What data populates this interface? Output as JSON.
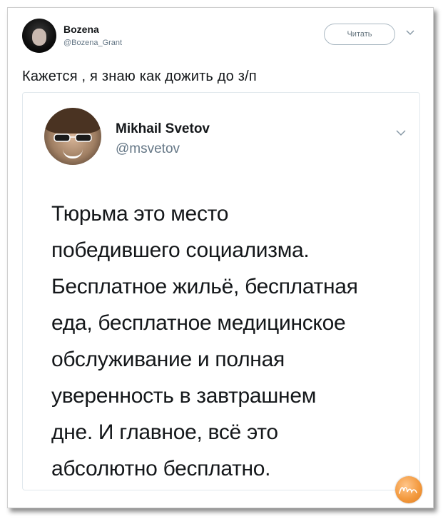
{
  "tweet": {
    "author_name": "Bozena",
    "author_handle": "@Bozena_Grant",
    "follow_label": "Читать",
    "text": "Кажется , я знаю как дожить до з/п"
  },
  "quoted": {
    "author_name": "Mikhail Svetov",
    "author_handle": "@msvetov",
    "lines": [
      "Тюрьма это место",
      "победившего социализма.",
      "Бесплатное жильё, бесплатная",
      "еда, бесплатное медицинское",
      "обслуживание и полная",
      "уверенность в завтрашнем",
      "дне. И главное, всё это",
      "абсолютно бесплатно."
    ]
  },
  "watermark": {
    "text": "Ника"
  },
  "icons": [
    "chevron-down-icon",
    "avatar"
  ],
  "colors": {
    "text": "#14171a",
    "secondary": "#657786",
    "border": "#e1e8ed",
    "watermark": "#f39a3f"
  }
}
